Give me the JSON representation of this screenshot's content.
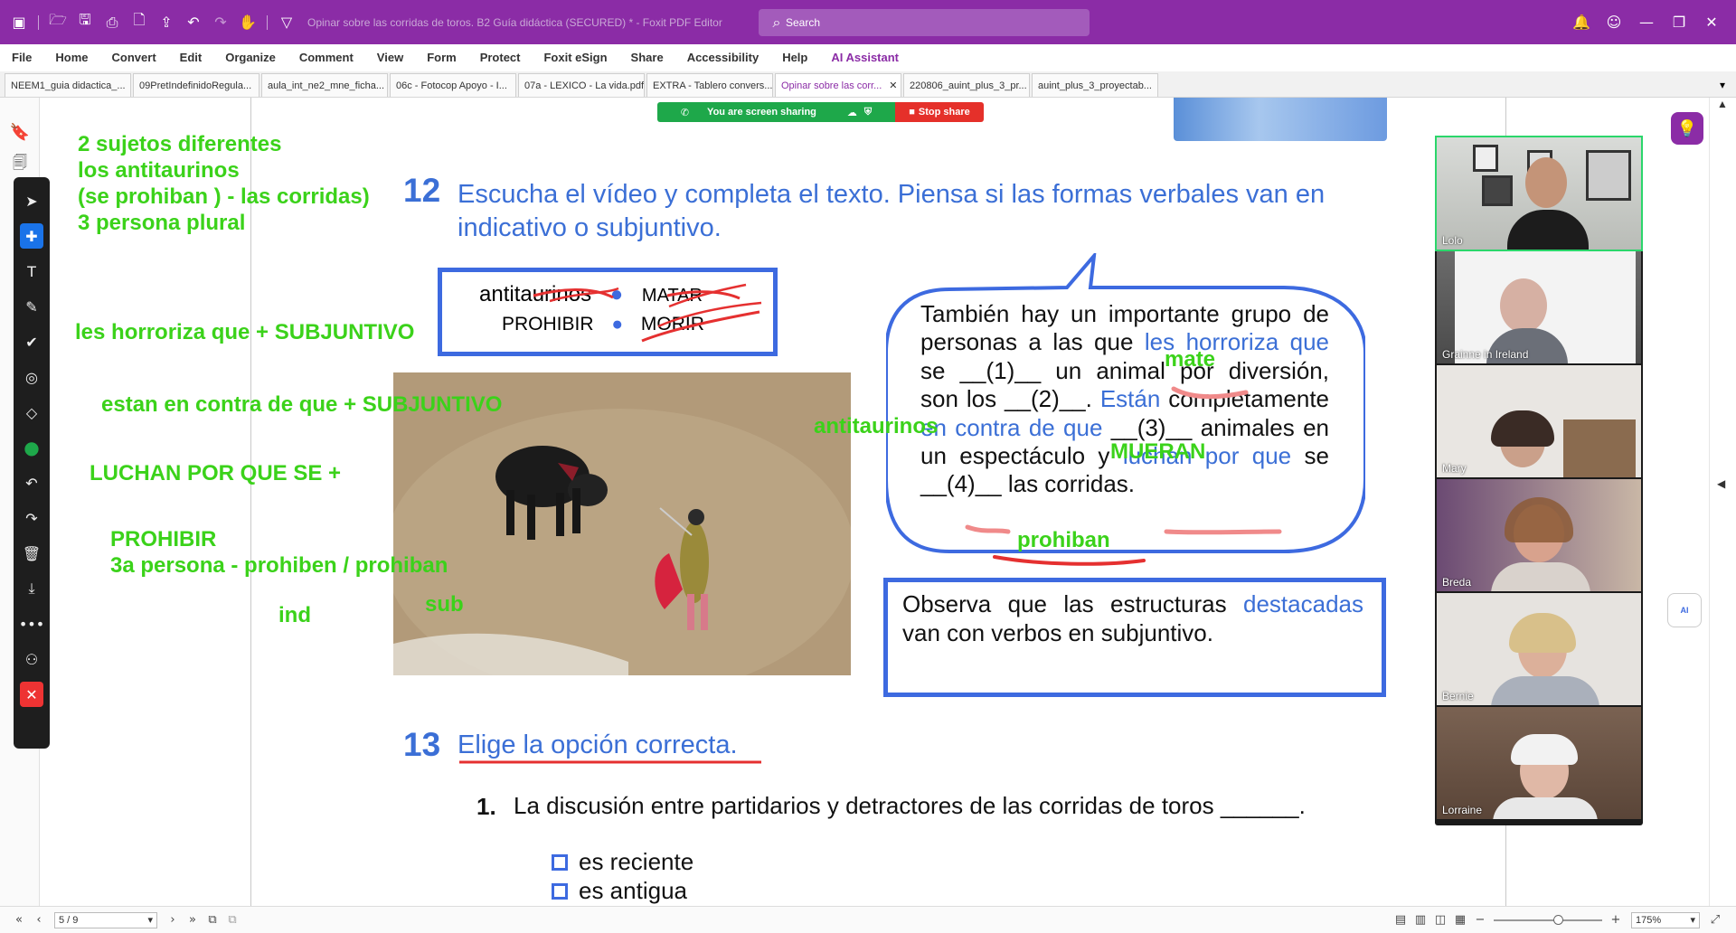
{
  "window": {
    "title": "Opinar sobre las corridas de toros. B2 Guía didáctica (SECURED) * - Foxit PDF Editor",
    "search_placeholder": "Search"
  },
  "menu": [
    "File",
    "Home",
    "Convert",
    "Edit",
    "Organize",
    "Comment",
    "View",
    "Form",
    "Protect",
    "Foxit eSign",
    "Share",
    "Accessibility",
    "Help",
    "AI Assistant"
  ],
  "tabs": [
    {
      "label": "NEEM1_guia didactica_..."
    },
    {
      "label": "09PretIndefinidoRegula..."
    },
    {
      "label": "aula_int_ne2_mne_ficha..."
    },
    {
      "label": "06c - Fotocop Apoyo - I..."
    },
    {
      "label": "07a - LEXICO - La vida.pdf"
    },
    {
      "label": "EXTRA - Tablero convers..."
    },
    {
      "label": "Opinar sobre las corr...",
      "active": true
    },
    {
      "label": "220806_auint_plus_3_pr..."
    },
    {
      "label": "auint_plus_3_proyectab..."
    }
  ],
  "share": {
    "status": "You are screen sharing",
    "stop": "Stop share"
  },
  "handwriting": {
    "n1": "2 sujetos diferentes",
    "n2": "los antitaurinos",
    "n3": "(se prohiban ) - las corridas)",
    "n4": "3 persona plural",
    "n5": "les horroriza que + SUBJUNTIVO",
    "n6": "estan en contra de que + SUBJUNTIVO",
    "n7": "LUCHAN POR QUE SE +",
    "n8": "PROHIBIR",
    "n9": "3a persona - prohiben / prohiban",
    "n10": "sub",
    "n11": "ind",
    "n12": "antitaurinos",
    "n13": "mate",
    "n14": "MUERAN",
    "n15": "prohiban"
  },
  "exercise12": {
    "number": "12",
    "instruction": "Escucha el vídeo y completa el texto. Piensa si las formas verbales van en indicativo o subjuntivo.",
    "words_row1": [
      "antitaurinos",
      "MATAR"
    ],
    "words_row2": [
      "PROHIBIR",
      "MORIR"
    ],
    "bubble": {
      "p1": "También hay un importante grupo de personas a las que ",
      "b1": "les horroriza que",
      "p2": " se __(1)__ un animal por diversión, son los __(2)__. ",
      "b2": "Están",
      "p3": " completamente ",
      "b3": "en contra de que",
      "p4": " __(3)__ animales en un espectáculo y ",
      "b4": "luchan por que",
      "p5": " se __(4)__ las corridas."
    },
    "observe": {
      "p1": "Observa que las estructuras ",
      "b1": "destacadas",
      "p2": " van con verbos en subjuntivo."
    }
  },
  "exercise13": {
    "number": "13",
    "instruction": "Elige la opción correcta.",
    "q1_number": "1.",
    "q1_text": "La discusión entre partidarios y detractores de las corridas de toros ______.",
    "options": [
      "es reciente",
      "es antigua"
    ]
  },
  "participants": [
    {
      "name": "Lolo",
      "active": true
    },
    {
      "name": "Grainne in Ireland"
    },
    {
      "name": "Mary"
    },
    {
      "name": "Breda"
    },
    {
      "name": "Bernie"
    },
    {
      "name": "Lorraine"
    }
  ],
  "statusbar": {
    "page": "5 / 9",
    "zoom": "175%"
  },
  "colors": {
    "accent": "#8b2ca6",
    "exercise_blue": "#3b6fd6",
    "handwriting_green": "#3bd21a",
    "pen_red": "#e53030"
  }
}
